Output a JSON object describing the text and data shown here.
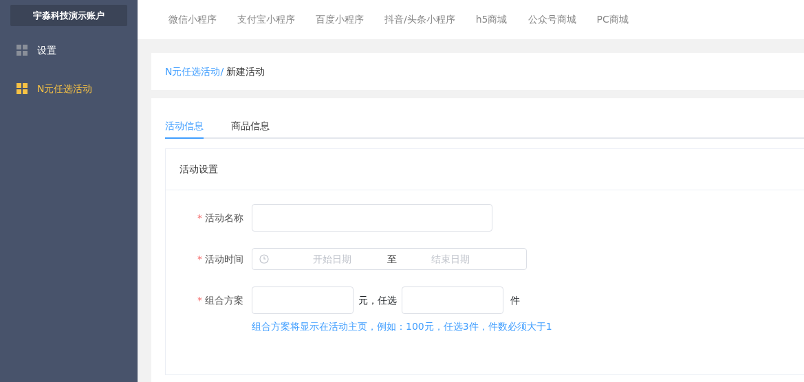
{
  "sidebar": {
    "account": "宇淼科技演示账户",
    "items": [
      {
        "label": "设置",
        "selected": false
      },
      {
        "label": "N元任选活动",
        "selected": true
      }
    ]
  },
  "top_nav": [
    "微信小程序",
    "支付宝小程序",
    "百度小程序",
    "抖音/头条小程序",
    "h5商城",
    "公众号商城",
    "PC商城"
  ],
  "breadcrumb": {
    "parent": "N元任选活动/",
    "current": "新建活动"
  },
  "tabs": [
    {
      "label": "活动信息",
      "selected": true
    },
    {
      "label": "商品信息",
      "selected": false
    }
  ],
  "section": {
    "title": "活动设置",
    "fields": [
      {
        "kind": "text",
        "label": "活动名称",
        "required_mark": "*"
      },
      {
        "kind": "daterange",
        "label": "活动时间",
        "required_mark": "*",
        "start_placeholder": "开始日期",
        "separator": "至",
        "end_placeholder": "结束日期"
      },
      {
        "kind": "combo",
        "label": "组合方案",
        "required_mark": "*",
        "middle": "元，任选",
        "suffix": "件",
        "hint": "组合方案将显示在活动主页，例如：100元，任选3件，件数必须大于1"
      }
    ]
  }
}
